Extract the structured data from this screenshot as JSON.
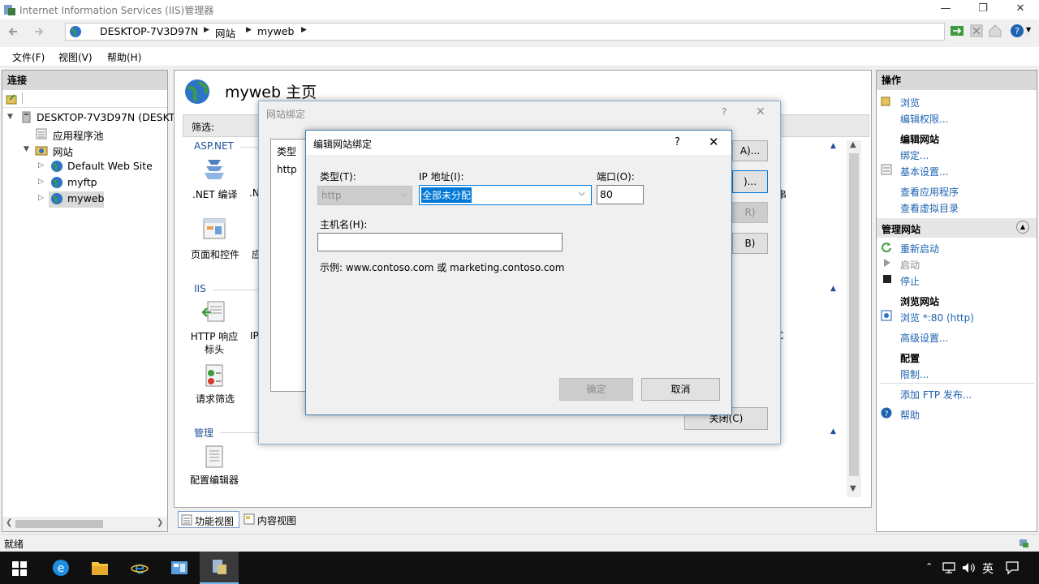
{
  "window": {
    "title": "Internet Information Services (IIS)管理器",
    "minimize": "—",
    "restore": "❐",
    "close": "✕"
  },
  "address": {
    "crumbs": [
      "DESKTOP-7V3D97N",
      "网站",
      "myweb"
    ]
  },
  "menu": [
    "文件(F)",
    "视图(V)",
    "帮助(H)"
  ],
  "connections": {
    "header": "连接",
    "tree": {
      "server": "DESKTOP-7V3D97N (DESKT",
      "app_pools": "应用程序池",
      "sites": "网站",
      "site1": "Default Web Site",
      "site2": "myftp",
      "site3": "myweb"
    }
  },
  "main": {
    "title": "myweb 主页",
    "filter_label": "筛选:",
    "group_aspnet": "ASP.NET",
    "group_iis": "IIS",
    "group_manage": "管理",
    "features": {
      "net_compile": ".NET 编译",
      "net_partial": ".N",
      "pages_controls": "页面和控件",
      "app_partial": "应",
      "http_headers": "HTTP 响应标头",
      "ip_partial": "IP",
      "request_filtering": "请求筛选",
      "config_editor": "配置编辑器"
    },
    "right_partial_1": "串",
    "right_partial_2": "C"
  },
  "bottom_tabs": {
    "features_view": "功能视图",
    "content_view": "内容视图"
  },
  "actions": {
    "header": "操作",
    "browse": "浏览",
    "edit_permissions": "编辑权限...",
    "edit_site_head": "编辑网站",
    "bindings": "绑定...",
    "basic_settings": "基本设置...",
    "view_apps": "查看应用程序",
    "view_vdirs": "查看虚拟目录",
    "manage_site_head": "管理网站",
    "restart": "重新启动",
    "start": "启动",
    "stop": "停止",
    "browse_site_head": "浏览网站",
    "browse_80": "浏览 *:80 (http)",
    "advanced": "高级设置...",
    "config_head": "配置",
    "limits": "限制...",
    "add_ftp": "添加 FTP 发布...",
    "help": "帮助"
  },
  "status": {
    "text": "就绪"
  },
  "bindings_dialog": {
    "title": "网站绑定",
    "help": "?",
    "close": "✕",
    "col_type": "类型",
    "row_type": "http",
    "btn_add_partial": "A)...",
    "btn_edit_partial": ")...",
    "btn_remove_partial": "R)",
    "btn_browse_partial": "B)",
    "btn_close": "关闭(C)"
  },
  "edit_dialog": {
    "title": "编辑网站绑定",
    "help": "?",
    "close": "✕",
    "type_label": "类型(T):",
    "type_value": "http",
    "ip_label": "IP 地址(I):",
    "ip_value": "全部未分配",
    "port_label": "端口(O):",
    "port_value": "80",
    "host_label": "主机名(H):",
    "host_value": "",
    "example": "示例: www.contoso.com 或 marketing.contoso.com",
    "ok": "确定",
    "cancel": "取消"
  },
  "taskbar": {
    "ime": "英"
  },
  "colors": {
    "accent": "#0078d7",
    "link": "#1e62b0",
    "selection": "#3399ff"
  }
}
